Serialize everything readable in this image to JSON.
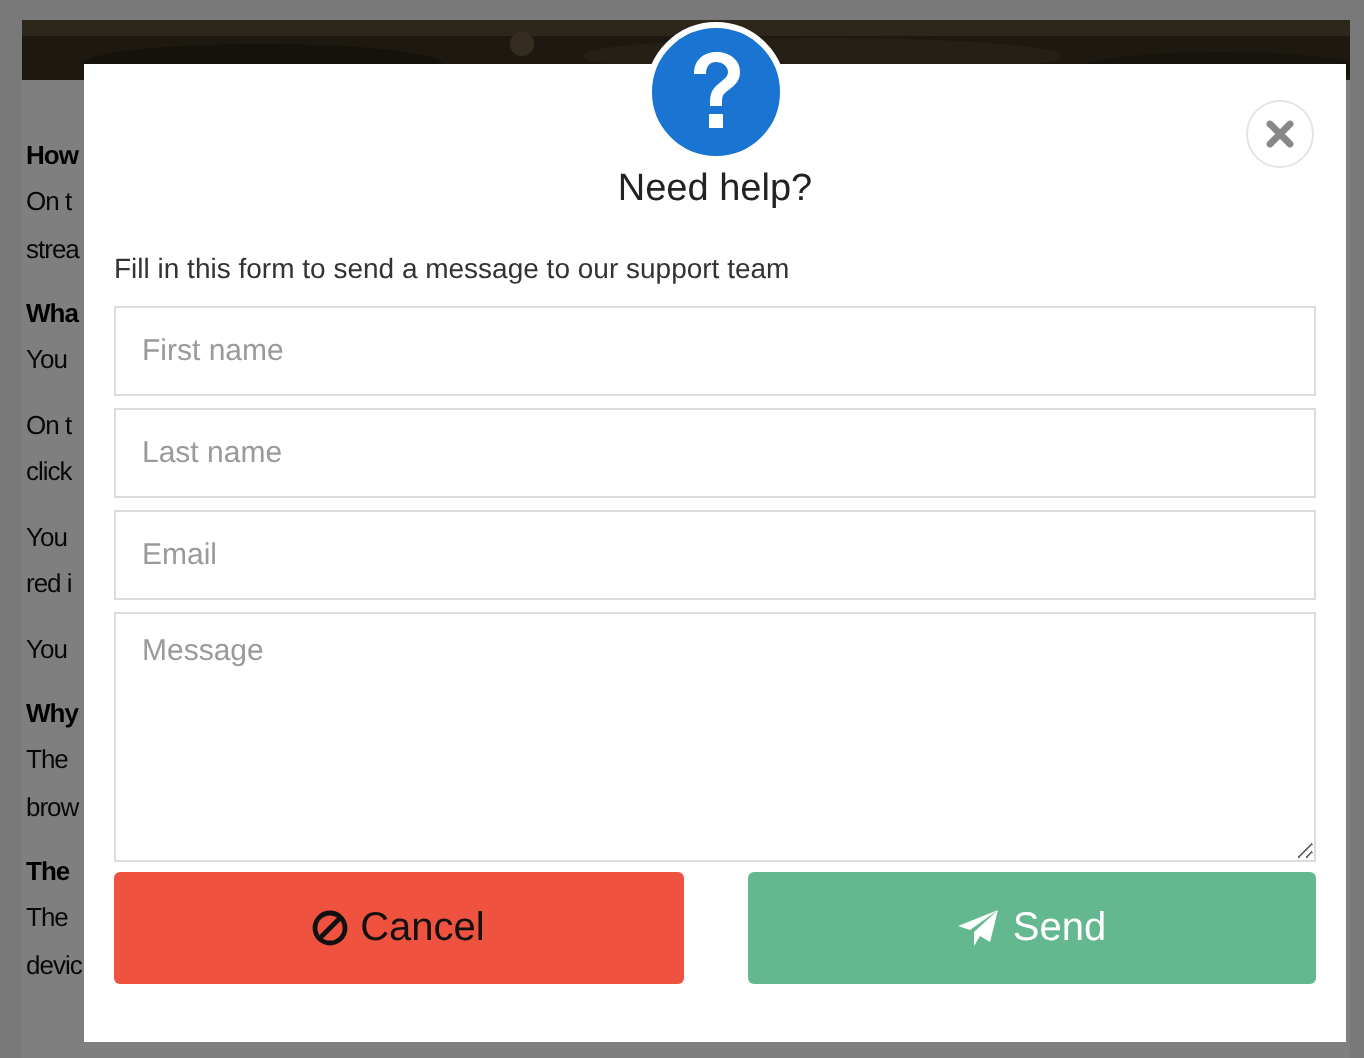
{
  "page": {
    "sections": [
      {
        "heading": "How",
        "paragraphs": [
          [
            {
              "left": "On t"
            },
            {
              "left": "strea"
            }
          ]
        ]
      },
      {
        "heading": "Wha",
        "paragraphs": [
          [
            {
              "left": "You"
            }
          ],
          [
            {
              "left": "On t"
            },
            {
              "left": "click"
            }
          ],
          [
            {
              "left": "You"
            },
            {
              "left": "red i"
            }
          ],
          [
            {
              "left": "You"
            }
          ]
        ]
      },
      {
        "heading": "Why",
        "paragraphs": [
          [
            {
              "left": "The"
            },
            {
              "left": "brow"
            }
          ]
        ]
      },
      {
        "heading": "The",
        "paragraphs": [
          [
            {
              "left": "The"
            },
            {
              "left": "devic"
            }
          ]
        ]
      }
    ]
  },
  "dialog": {
    "title": "Need help?",
    "intro": "Fill in this form to send a message to our support team",
    "fields": [
      {
        "kind": "line",
        "placeholder": "First name"
      },
      {
        "kind": "line",
        "placeholder": "Last name"
      },
      {
        "kind": "line",
        "placeholder": "Email"
      },
      {
        "kind": "area",
        "placeholder": "Message"
      }
    ],
    "buttons": [
      {
        "kind": "cancel",
        "label": "Cancel"
      },
      {
        "kind": "send",
        "label": "Send"
      }
    ]
  }
}
